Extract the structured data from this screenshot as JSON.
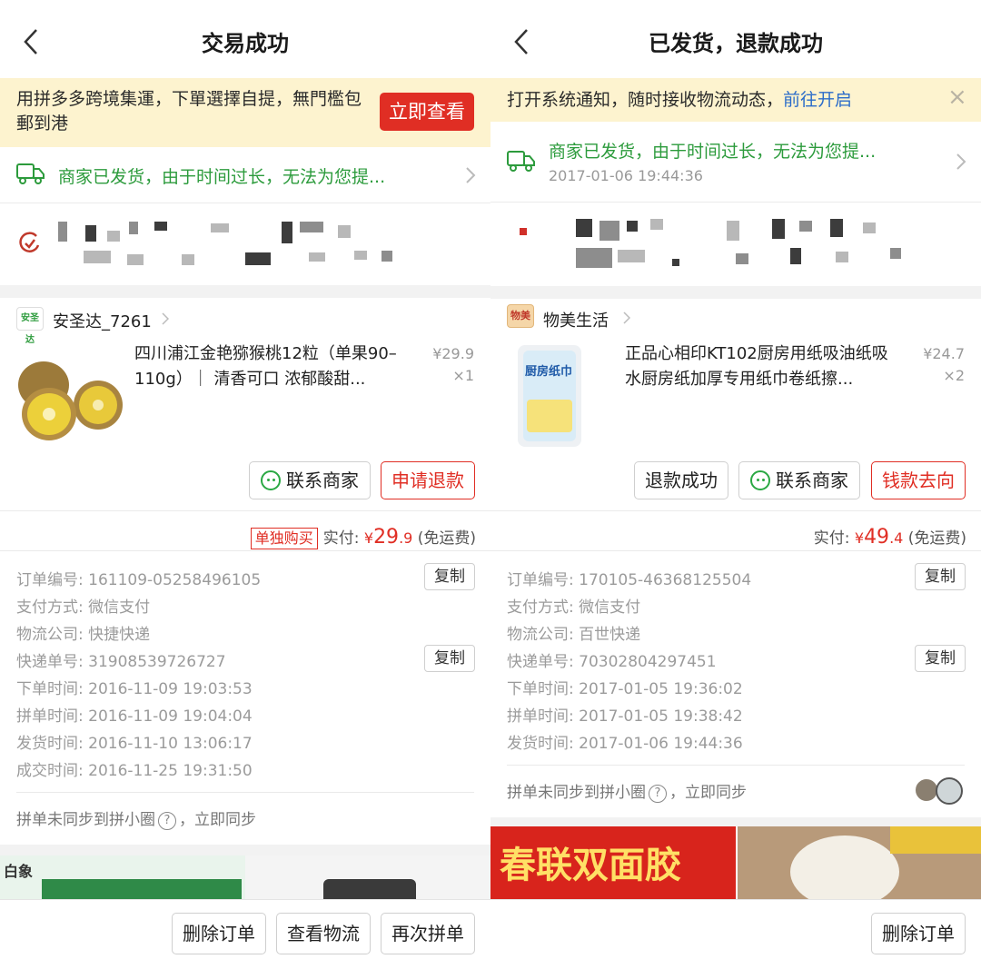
{
  "left": {
    "title": "交易成功",
    "banner": {
      "text": "用拼多多跨境集運，下單選擇自提，無門檻包郵到港",
      "button": "立即查看"
    },
    "shipping": {
      "text": "商家已发货，由于时间过长，无法为您提..."
    },
    "shop": {
      "name": "安圣达_7261",
      "logo_text": "安圣达"
    },
    "product": {
      "title": "四川浦江金艳猕猴桃12粒（单果90–110g）｜ 清香可口 浓郁酸甜...",
      "price": "¥29.9",
      "qty": "×1"
    },
    "actions": {
      "contact": "联系商家",
      "refund": "申请退款"
    },
    "payment": {
      "tag": "单独购买",
      "label": "实付:",
      "currency": "¥",
      "amount_int": "29",
      "amount_dec": ".9",
      "shipping": "(免运费)"
    },
    "info": [
      {
        "label": "订单编号:",
        "value": "161109-05258496105",
        "copy": "复制"
      },
      {
        "label": "支付方式:",
        "value": "微信支付"
      },
      {
        "label": "物流公司:",
        "value": "快捷快递"
      },
      {
        "label": "快递单号:",
        "value": "31908539726727",
        "copy": "复制"
      },
      {
        "label": "下单时间:",
        "value": "2016-11-09 19:03:53"
      },
      {
        "label": "拼单时间:",
        "value": "2016-11-09 19:04:04"
      },
      {
        "label": "发货时间:",
        "value": "2016-11-10 13:06:17"
      },
      {
        "label": "成交时间:",
        "value": "2016-11-25 19:31:50"
      }
    ],
    "sync": {
      "text1": "拼单未同步到拼小圈",
      "q": "?",
      "text2": "，立即同步"
    },
    "ad": {
      "logo_text": "白象"
    },
    "bottom": {
      "delete": "删除订单",
      "logistics": "查看物流",
      "regroup": "再次拼单"
    }
  },
  "right": {
    "title": "已发货，退款成功",
    "banner": {
      "text": "打开系统通知，随时接收物流动态，",
      "link": "前往开启",
      "close": "×"
    },
    "shipping": {
      "text": "商家已发货，由于时间过长，无法为您提...",
      "time": "2017-01-06 19:44:36"
    },
    "shop": {
      "name": "物美生活",
      "logo_text": "物美"
    },
    "product": {
      "title": "正品心相印KT102厨房用纸吸油纸吸水厨房纸加厚专用纸巾卷纸擦...",
      "price": "¥24.7",
      "qty": "×2",
      "pack_text": "厨房纸巾"
    },
    "actions": {
      "refund_done": "退款成功",
      "contact": "联系商家",
      "money_flow": "钱款去向"
    },
    "payment": {
      "label": "实付:",
      "currency": "¥",
      "amount_int": "49",
      "amount_dec": ".4",
      "shipping": "(免运费)"
    },
    "info": [
      {
        "label": "订单编号:",
        "value": "170105-46368125504",
        "copy": "复制"
      },
      {
        "label": "支付方式:",
        "value": "微信支付"
      },
      {
        "label": "物流公司:",
        "value": "百世快递"
      },
      {
        "label": "快递单号:",
        "value": "70302804297451",
        "copy": "复制"
      },
      {
        "label": "下单时间:",
        "value": "2017-01-05 19:36:02"
      },
      {
        "label": "拼单时间:",
        "value": "2017-01-05 19:38:42"
      },
      {
        "label": "发货时间:",
        "value": "2017-01-06 19:44:36"
      }
    ],
    "sync": {
      "text1": "拼单未同步到拼小圈",
      "q": "?",
      "text2": "，立即同步"
    },
    "ad": {
      "text": "春联双面胶"
    },
    "bottom": {
      "delete": "删除订单"
    }
  },
  "colors": {
    "accent_red": "#e02e24",
    "ship_green": "#2c9b3c",
    "banner_bg": "#fdf3cf",
    "link_blue": "#2b6cc9"
  }
}
